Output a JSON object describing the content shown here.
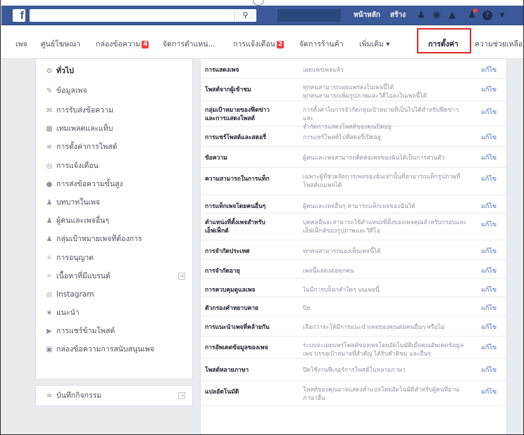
{
  "topbar": {
    "logo": "f",
    "search_placeholder": "",
    "links": [
      "หน้าหลัก",
      "สร้าง"
    ],
    "icons": [
      "friends-icon",
      "messenger-icon",
      "notifications-icon",
      "help-icon",
      "dropdown-icon"
    ]
  },
  "page_nav": {
    "items": [
      {
        "label": "เพจ"
      },
      {
        "label": "ศูนย์โฆษณา"
      },
      {
        "label": "กล่องข้อความ",
        "badge": "4"
      },
      {
        "label": "จัดการตำแหน่..."
      },
      {
        "label": "การแจ้งเตือน",
        "badge": "2"
      },
      {
        "label": "จัดการร้านค้า"
      },
      {
        "label": "เพิ่มเติม ▾"
      }
    ],
    "active": "การตั้งค่า",
    "help": "ความช่วยเหลือ ▾"
  },
  "sidebar": {
    "items": [
      {
        "icon": "gear-icon",
        "glyph": "⚙",
        "label": "ทั่วไป",
        "active": true
      },
      {
        "icon": "pencil-icon",
        "glyph": "✎",
        "label": "ข้อมูลเพจ"
      },
      {
        "icon": "inbox-icon",
        "glyph": "✉",
        "label": "การรับส่งข้อความ"
      },
      {
        "icon": "grid-icon",
        "glyph": "▦",
        "label": "เทมเพลตและแท็บ"
      },
      {
        "icon": "list-icon",
        "glyph": "≡",
        "label": "การตั้งค่าการโพสต์"
      },
      {
        "icon": "globe-icon",
        "glyph": "◎",
        "label": "การแจ้งเตือน"
      },
      {
        "icon": "message-icon",
        "glyph": "●",
        "label": "การส่งข้อความขั้นสูง"
      },
      {
        "icon": "person-icon",
        "glyph": "♟",
        "label": "บทบาทในเพจ"
      },
      {
        "icon": "people-icon",
        "glyph": "♟",
        "label": "ผู้คนและเพจอื่นๆ"
      },
      {
        "icon": "audience-icon",
        "glyph": "♟",
        "label": "กลุ่มเป้าหมายเพจที่ต้องการ"
      },
      {
        "icon": "wrench-icon",
        "glyph": "✧",
        "label": "การอนุญาต"
      },
      {
        "icon": "handshake-icon",
        "glyph": "✧",
        "label": "เนื้อหาที่มีแบรนด์",
        "arrow": true
      },
      {
        "icon": "instagram-icon",
        "glyph": "◎",
        "label": "Instagram"
      },
      {
        "icon": "star-icon",
        "glyph": "★",
        "label": "แนะนำ"
      },
      {
        "icon": "video-icon",
        "glyph": "▶",
        "label": "การแชร์ข้ามโพสต์"
      },
      {
        "icon": "support-inbox-icon",
        "glyph": "▣",
        "label": "กล่องข้อความการสนับสนุนเพจ"
      }
    ],
    "activity_log": {
      "icon": "log-icon",
      "glyph": "≡",
      "label": "บันทึกกิจกรรม"
    }
  },
  "settings": {
    "edit_label": "แก้ไข",
    "rows": [
      {
        "label": "การแสดงเพจ",
        "value": "เผยแพร่เพจแล้ว"
      },
      {
        "label": "โพสต์จากผู้เข้าชม",
        "value": "ทุกคนสามารถเผยแพร่ลงในเพจนี้ได้\nทุกคนสามารถเพิ่มรูปภาพและวิดีโอลงในเพจนี้ได้"
      },
      {
        "label": "กลุ่มเป้าหมายของฟีดข่าว\nและการแสดงโพสต์",
        "value": "การตั้งค่าในการจำกัดกลุ่มเป้าหมายที่เป็นไปได้สำหรับฟีดข่าวและ\nจำกัดการแสดงโพสต์ของคุณปิดอยู่"
      },
      {
        "label": "การแชร์โพสต์และสตอรี่",
        "value": "การแชร์โพสต์ไปที่สตอรี่เปิดอยู่"
      },
      {
        "label": "ข้อความ",
        "value": "ผู้คนและเพจสามารถติดต่อเพจของฉันได้เป็นการส่วนตัว"
      },
      {
        "label": "ความสามารถในการแท็ก",
        "value": "เฉพาะผู้ที่ช่วยจัดการเพจของฉันเท่านั้นที่สามารถแท็กรูปภาพที่\nโพสต์บนเพจได้"
      },
      {
        "label": "การแท็กเพจโดยคนอื่นๆ",
        "value": "ผู้คนและเพจอื่นๆ สามารถแท็กเพจของฉันได้"
      },
      {
        "label": "ตำแหน่งที่ตั้งเพจสำหรับ\nเอ็ฟเฟ็กต์",
        "value": "บุคคลอื่นจะสามารถใช้ตำแหน่งที่ตั้งของเพจคุณสำหรับกรอบและ\nเอ็ฟเฟ็กต์ของรูปภาพและวิดีโอ"
      },
      {
        "label": "การจำกัดประเทศ",
        "value": "ทุกคนสามารถมองเห็นเพจนี้ได้"
      },
      {
        "label": "การจำกัดอายุ",
        "value": "เพจนี้แสดงต่อทุกคน"
      },
      {
        "label": "การควบคุมดูแลเพจ",
        "value": "ไม่มีการบล็อกคำใดๆ บนเพจนี้"
      },
      {
        "label": "ตัวกรองคำหยาบคาย",
        "value": "ปิด"
      },
      {
        "label": "การแนะนำเพจที่คล้ายกัน",
        "value": "เลือกว่าจะให้มีการแนะนำเพจของคุณต่อคนอื่นๆ หรือไม่"
      },
      {
        "label": "การอัพเดตข้อมูลของเพจ",
        "value": "ระบบจะเผยแพร่โพสต์ของเพจโดยอัตโนมัติเมื่อคุณอัพเดตข้อมูล\nเพจ บรรลุเป้าหมายที่สำคัญ ได้รับคำติชม และอื่นๆ"
      },
      {
        "label": "โพสต์หลายภาษา",
        "value": "ปิดใช้งานฟีเจอร์การโพสต์ในหลายภาษา"
      },
      {
        "label": "แปลอัตโนมัติ",
        "value": "โพสต์ของคุณอาจแสดงคำแปลโดยอัตโนมัติสำหรับผู้คนที่อ่าน\nภาษาอื่น"
      }
    ]
  }
}
